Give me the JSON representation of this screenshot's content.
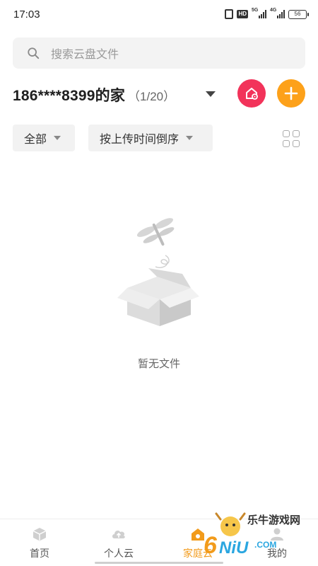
{
  "status_bar": {
    "time": "17:03",
    "network_1": "5G",
    "network_2": "4G",
    "hd_badge": "HD",
    "battery": "56"
  },
  "search": {
    "placeholder": "搜索云盘文件"
  },
  "family": {
    "name": "186****8399的家",
    "member_count": "（1/20）"
  },
  "filters": {
    "type_label": "全部",
    "sort_label": "按上传时间倒序"
  },
  "empty_state": {
    "message": "暂无文件"
  },
  "bottom_nav": {
    "items": [
      {
        "label": "首页",
        "icon": "cube-icon"
      },
      {
        "label": "个人云",
        "icon": "cloud-upload-icon"
      },
      {
        "label": "家庭云",
        "icon": "family-home-icon",
        "active": true
      },
      {
        "label": "我的",
        "icon": "user-icon"
      }
    ]
  },
  "watermark": {
    "text": "乐牛游戏网",
    "logo_text": "6NiU.COM"
  },
  "colors": {
    "accent": "#f29b1b",
    "home_button": "#f2335a",
    "add_button": "#fda11a"
  }
}
